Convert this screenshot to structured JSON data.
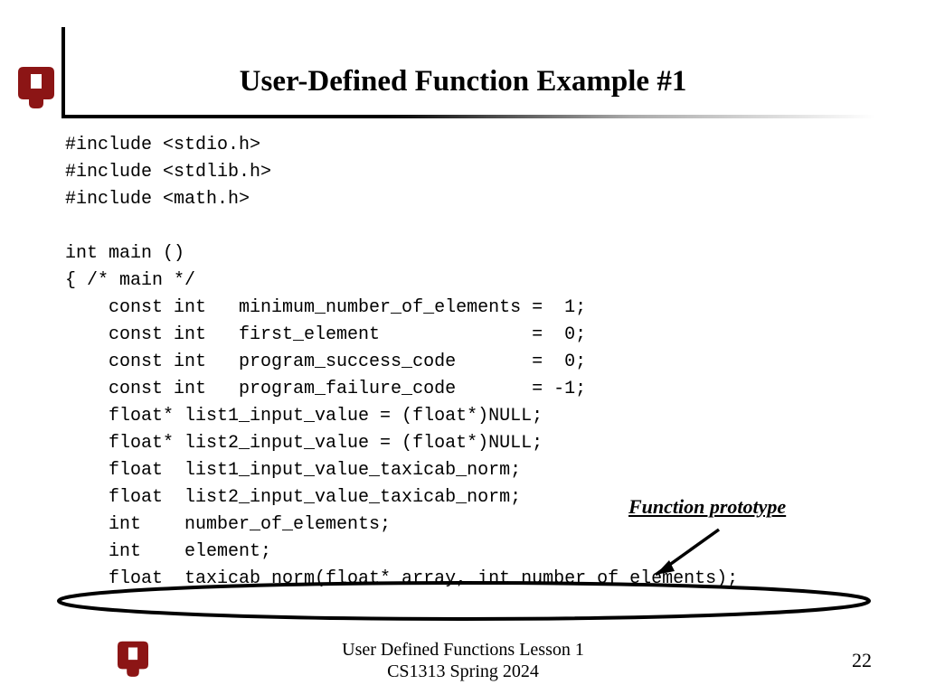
{
  "title": "User-Defined Function Example #1",
  "code": "#include <stdio.h>\n#include <stdlib.h>\n#include <math.h>\n\nint main ()\n{ /* main */\n    const int   minimum_number_of_elements =  1;\n    const int   first_element              =  0;\n    const int   program_success_code       =  0;\n    const int   program_failure_code       = -1;\n    float* list1_input_value = (float*)NULL;\n    float* list2_input_value = (float*)NULL;\n    float  list1_input_value_taxicab_norm;\n    float  list2_input_value_taxicab_norm;\n    int    number_of_elements;\n    int    element;\n    float  taxicab_norm(float* array, int number_of_elements);",
  "annotation": "Function prototype",
  "footer_line1": "User Defined Functions Lesson 1",
  "footer_line2": "CS1313 Spring 2024",
  "page_number": "22",
  "colors": {
    "crimson": "#8C1515"
  }
}
